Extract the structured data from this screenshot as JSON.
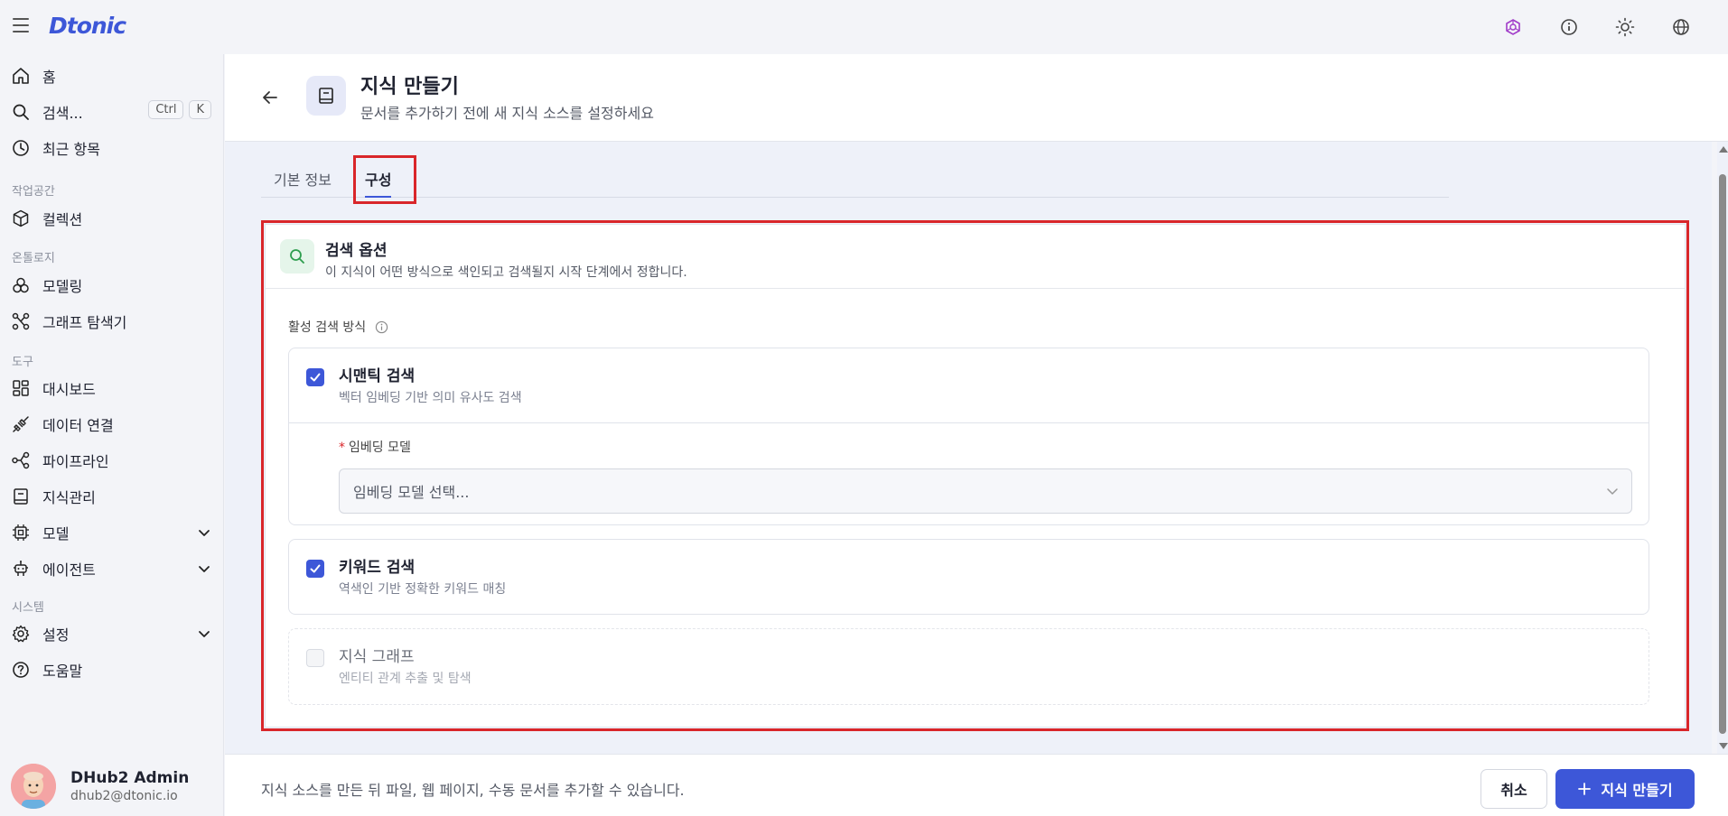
{
  "app": {
    "logo": "Dtonic"
  },
  "topbar": {
    "icons": [
      "ontology-icon",
      "info-icon",
      "sun-icon",
      "globe-icon"
    ]
  },
  "sidebar": {
    "home": "홈",
    "search": "검색...",
    "search_kbd": [
      "Ctrl",
      "K"
    ],
    "recent": "최근 항목",
    "section_workspace": "작업공간",
    "collection": "컬렉션",
    "section_ontology": "온톨로지",
    "modeling": "모델링",
    "graph_explorer": "그래프 탐색기",
    "section_tools": "도구",
    "dashboard": "대시보드",
    "data_connection": "데이터 연결",
    "pipeline": "파이프라인",
    "knowledge_mgmt": "지식관리",
    "model": "모델",
    "agent": "에이전트",
    "section_system": "시스템",
    "settings": "설정",
    "help": "도움말",
    "user": {
      "name": "DHub2 Admin",
      "email": "dhub2@dtonic.io"
    }
  },
  "header": {
    "title": "지식 만들기",
    "subtitle": "문서를 추가하기 전에 새 지식 소스를 설정하세요"
  },
  "tabs": [
    {
      "label": "기본 정보",
      "active": false
    },
    {
      "label": "구성",
      "active": true
    }
  ],
  "search_options": {
    "title": "검색 옵션",
    "description": "이 지식이 어떤 방식으로 색인되고 검색될지 시작 단계에서 정합니다.",
    "active_label": "활성 검색 방식",
    "semantic": {
      "title": "시맨틱 검색",
      "description": "벡터 임베딩 기반 의미 유사도 검색",
      "checked": true,
      "embedding_label": "임베딩 모델",
      "embedding_placeholder": "임베딩 모델 선택..."
    },
    "keyword": {
      "title": "키워드 검색",
      "description": "역색인 기반 정확한 키워드 매칭",
      "checked": true
    },
    "graph": {
      "title": "지식 그래프",
      "description": "엔티티 관계 추출 및 탐색",
      "checked": false
    }
  },
  "footer": {
    "hint": "지식 소스를 만든 뒤 파일, 웹 페이지, 수동 문서를 추가할 수 있습니다.",
    "cancel": "취소",
    "create": "지식 만들기"
  },
  "colors": {
    "accent": "#3d57d8",
    "highlight": "#d9262a"
  }
}
